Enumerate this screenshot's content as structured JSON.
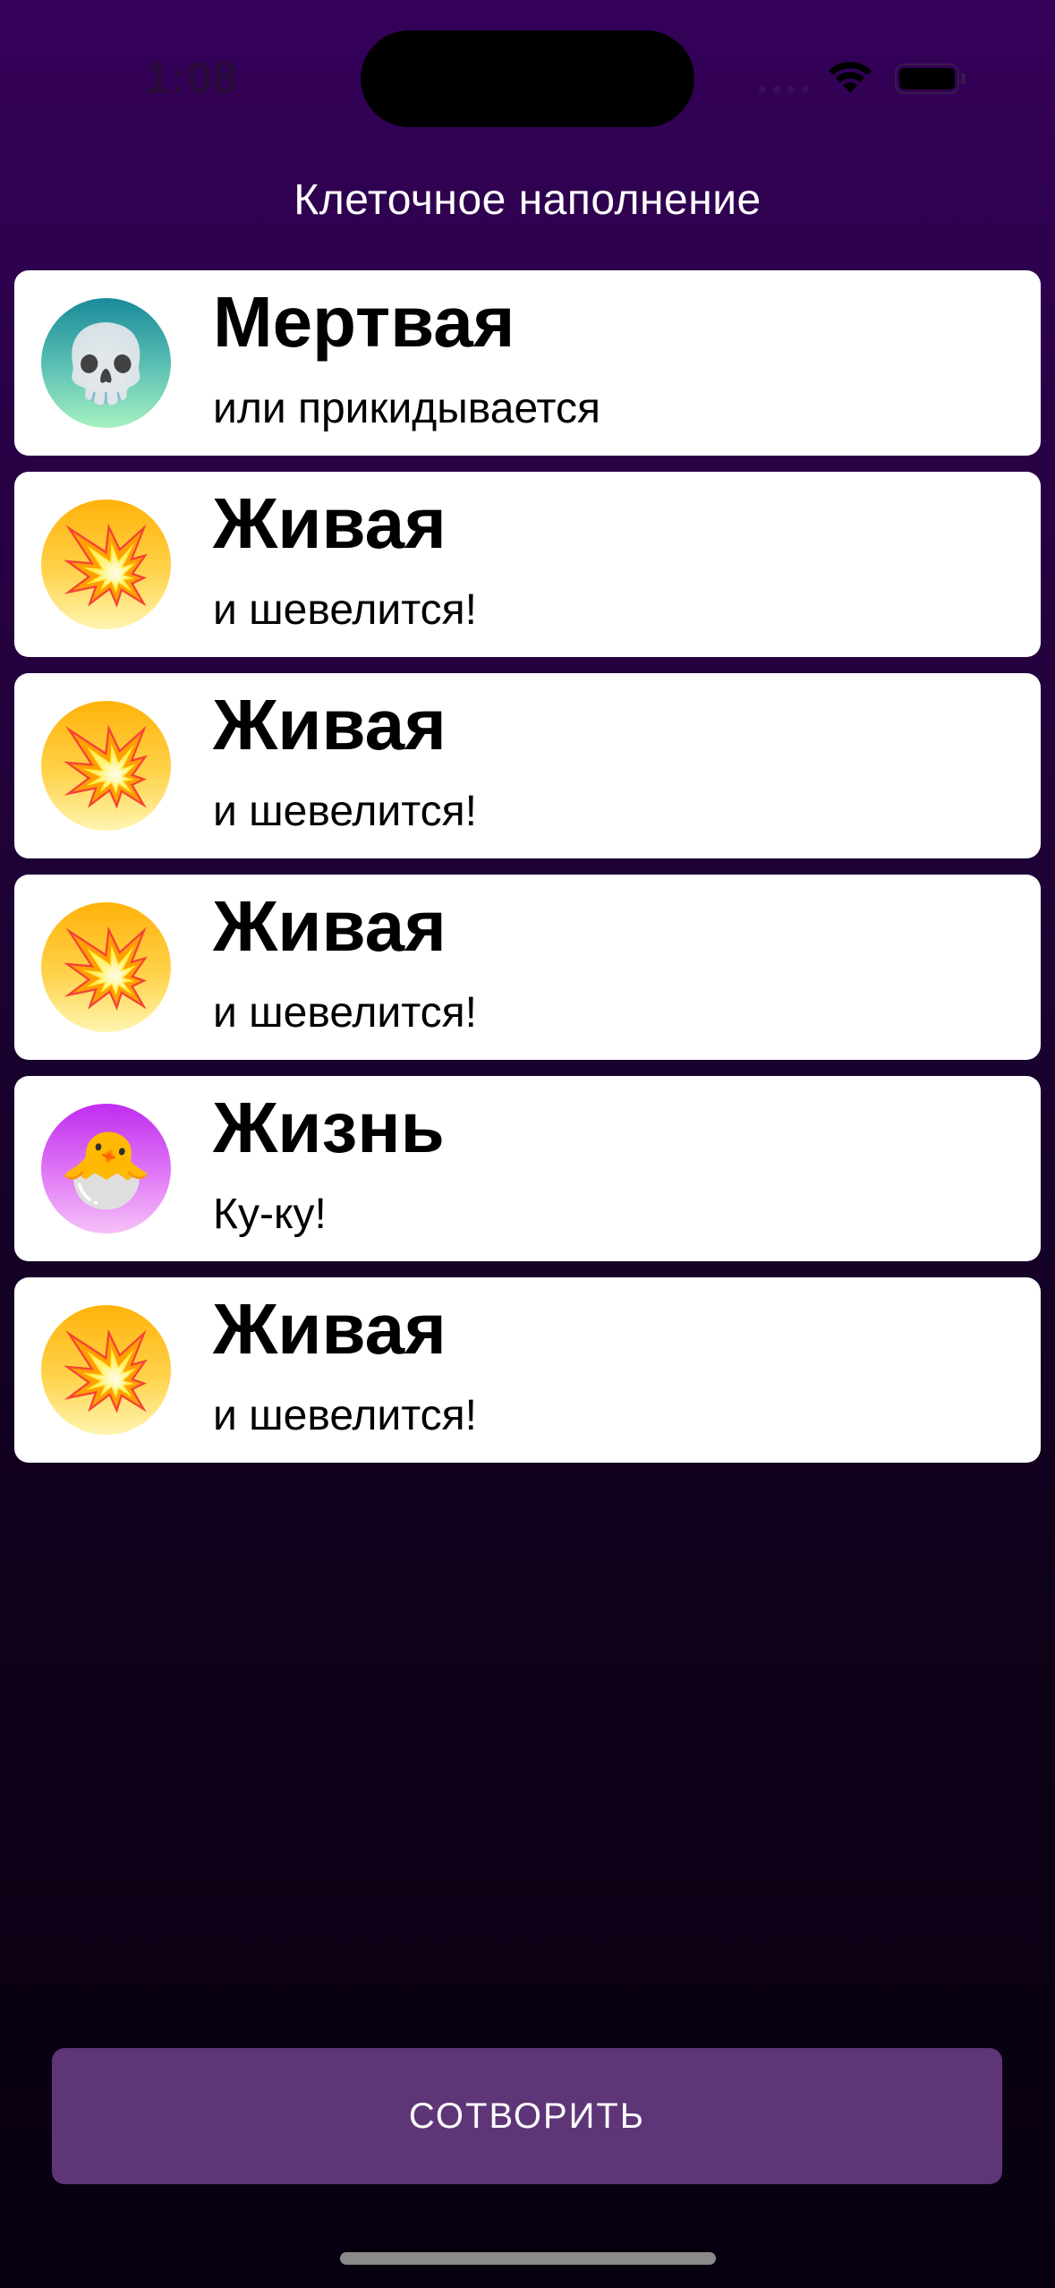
{
  "status_bar": {
    "time": "1:08"
  },
  "nav": {
    "title": "Клеточное наполнение"
  },
  "cells": [
    {
      "kind": "dead",
      "emoji": "💀",
      "icon": "skull-icon",
      "title": "Мертвая",
      "subtitle": "или прикидывается"
    },
    {
      "kind": "alive",
      "emoji": "💥",
      "icon": "explosion-icon",
      "title": "Живая",
      "subtitle": "и шевелится!"
    },
    {
      "kind": "alive",
      "emoji": "💥",
      "icon": "explosion-icon",
      "title": "Живая",
      "subtitle": "и шевелится!"
    },
    {
      "kind": "alive",
      "emoji": "💥",
      "icon": "explosion-icon",
      "title": "Живая",
      "subtitle": "и шевелится!"
    },
    {
      "kind": "life",
      "emoji": "🐣",
      "icon": "hatching-chick-icon",
      "title": "Жизнь",
      "subtitle": "Ку-ку!"
    },
    {
      "kind": "alive",
      "emoji": "💥",
      "icon": "explosion-icon",
      "title": "Живая",
      "subtitle": "и шевелится!"
    }
  ],
  "actions": {
    "create_label": "СОТВОРИТЬ"
  },
  "colors": {
    "background_top": "#34015a",
    "background_bottom": "#080010",
    "button": "#5e3577",
    "cell": "#ffffff"
  }
}
